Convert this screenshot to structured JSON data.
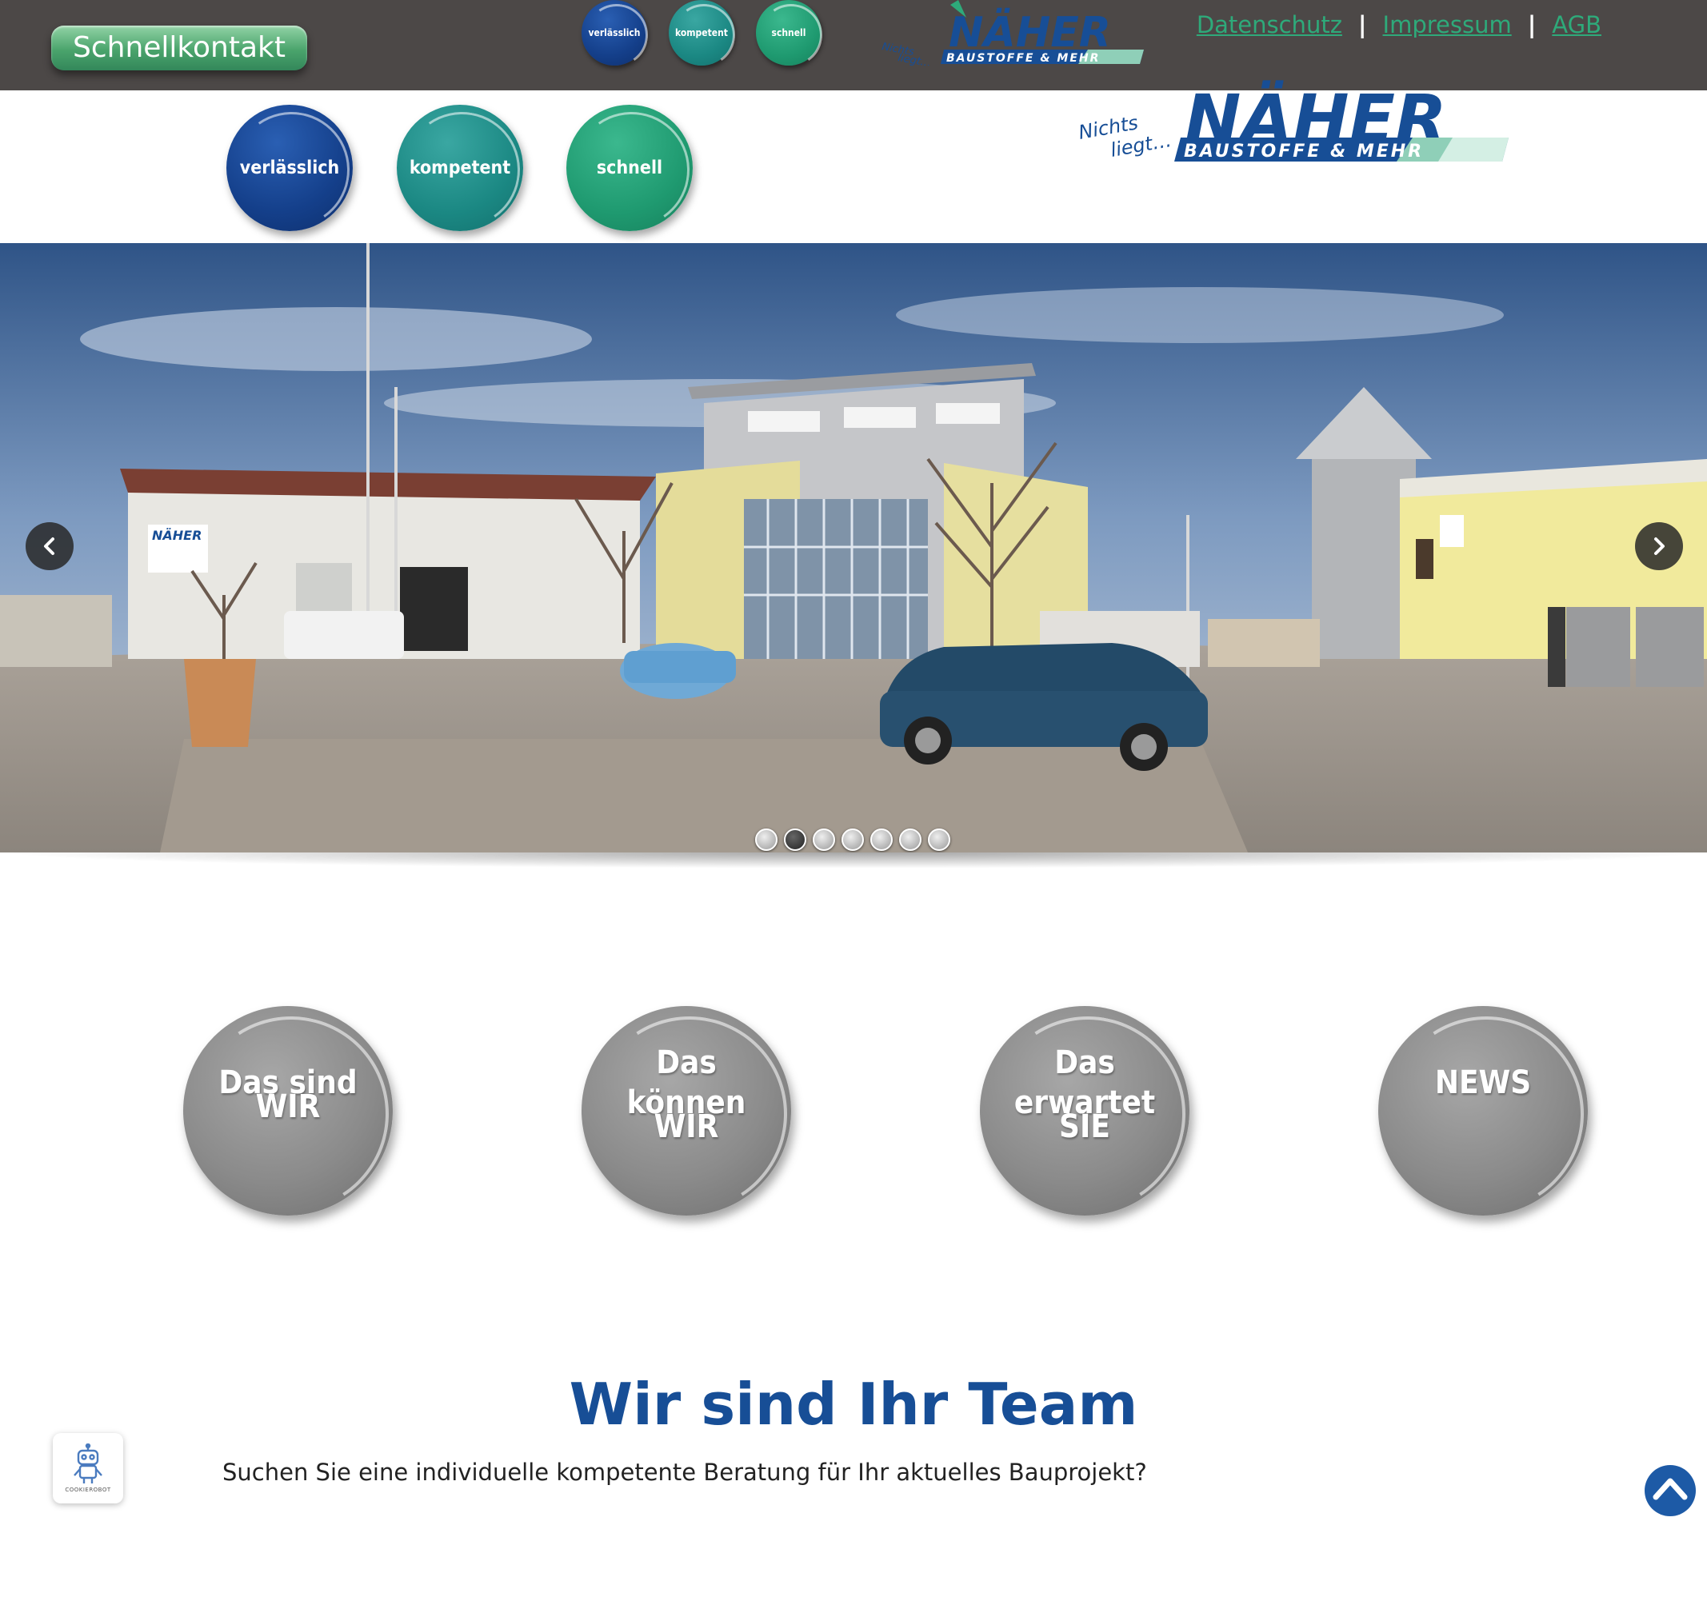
{
  "topbar": {
    "quick_contact": "Schnellkontakt",
    "badges": [
      "verlässlich",
      "kompetent",
      "schnell"
    ],
    "links": {
      "privacy": "Datenschutz",
      "imprint": "Impressum",
      "terms": "AGB"
    },
    "separator": "|"
  },
  "logo": {
    "brand": "NÄHER",
    "tagline_line1": "Nichts",
    "tagline_line2": "liegt…",
    "sub": "BAUSTOFFE & MEHR"
  },
  "header": {
    "badges": [
      "verlässlich",
      "kompetent",
      "schnell"
    ]
  },
  "slider": {
    "sign_text": "NÄHER",
    "slide_count": 7,
    "active_index": 1
  },
  "features": [
    {
      "line1": "Das sind",
      "line2": "WIR"
    },
    {
      "line1": "Das können",
      "line2": "WIR"
    },
    {
      "line1": "Das erwartet",
      "line2": "SIE"
    },
    {
      "line1": "NEWS",
      "line2": ""
    }
  ],
  "team": {
    "title": "Wir sind Ihr Team",
    "text": "Suchen Sie eine individuelle kompetente Beratung für Ihr aktuelles Bauprojekt?"
  },
  "cookie": {
    "label": "COOKIEROBOT"
  },
  "colors": {
    "topbar": "#4c4847",
    "brand_blue": "#174e96",
    "brand_green": "#2eaa7a",
    "link_green": "#2eaa7a"
  }
}
